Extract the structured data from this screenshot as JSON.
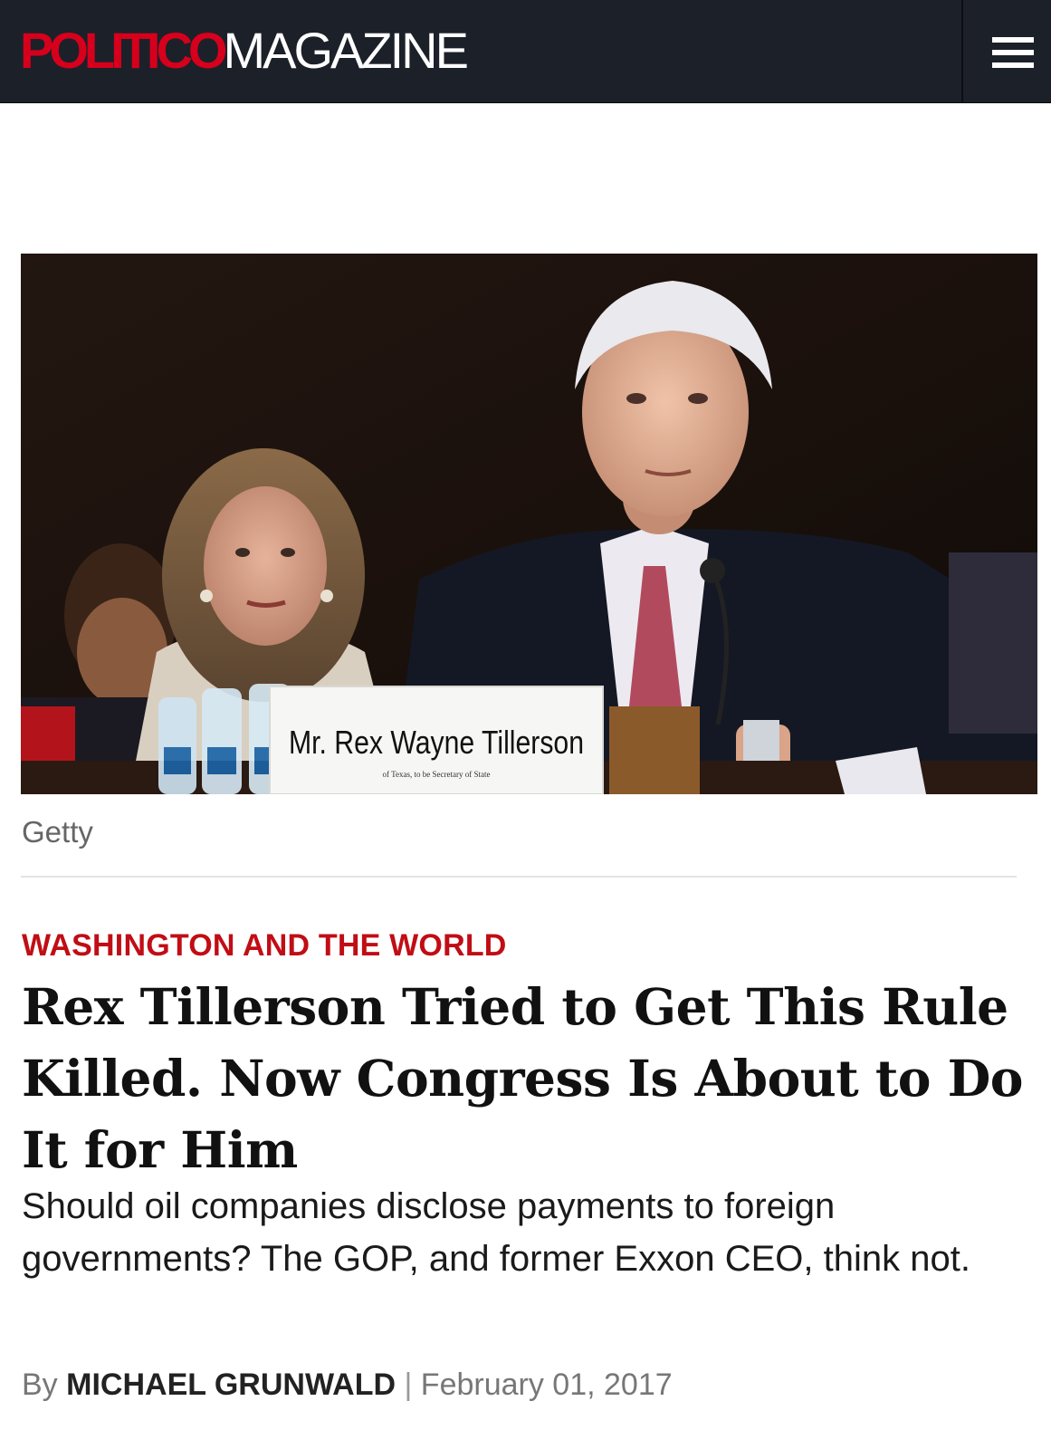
{
  "header": {
    "logo_primary": "POLITICO",
    "logo_secondary": "MAGAZINE",
    "menu_icon": "hamburger-menu-icon",
    "background_color": "#1c2029",
    "brand_color": "#d6001c"
  },
  "hero": {
    "nameplate_name": "Mr. Rex Wayne Tillerson",
    "nameplate_subtitle": "of Texas, to be Secretary of State",
    "credit": "Getty"
  },
  "article": {
    "section": "WASHINGTON AND THE WORLD",
    "section_color": "#c10d15",
    "headline": "Rex Tillerson Tried to Get This Rule Killed. Now Congress Is About to Do It for Him",
    "dek": "Should oil companies disclose payments to foreign governments? The GOP, and former Exxon CEO, think not.",
    "byline_prefix": "By",
    "author": "MICHAEL GRUNWALD",
    "separator": "|",
    "date": "February 01, 2017"
  }
}
